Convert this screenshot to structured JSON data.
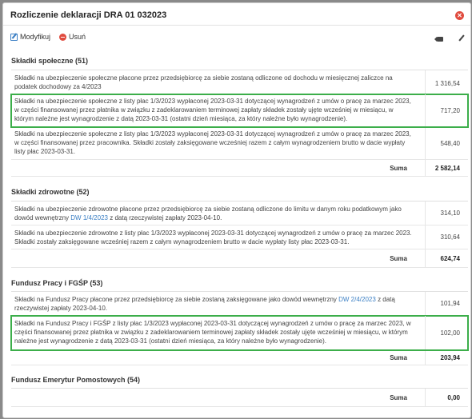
{
  "dialog": {
    "title": "Rozliczenie deklaracji DRA 01 032023",
    "toolbar": {
      "edit": "Modyfikuj",
      "delete": "Usuń"
    },
    "icons": {
      "close": "close-icon",
      "edit": "edit-icon",
      "delete": "delete-icon",
      "tag": "tag-icon",
      "pencil": "pencil-icon"
    },
    "colors": {
      "highlight": "#3cae4a",
      "close": "#e04b3e",
      "link": "#3b7fc4"
    }
  },
  "sections": [
    {
      "title": "Składki społeczne (51)",
      "rows": [
        {
          "text": "Składki na ubezpieczenie społeczne płacone przez przedsiębiorcę za siebie zostaną odliczone od dochodu w miesięcznej zaliczce na podatek dochodowy za 4/2023",
          "amount": "1 316,54"
        },
        {
          "text": "Składki na ubezpieczenie społeczne z listy płac 1/3/2023 wypłaconej 2023-03-31 dotyczącej wynagrodzeń z umów o pracę za marzec 2023, w części finansowanej przez płatnika w związku z zadeklarowaniem terminowej zapłaty składek zostały ujęte wcześniej w miesiącu, w którym należne jest wynagrodzenie z datą 2023-03-31 (ostatni dzień miesiąca, za który należne było wynagrodzenie).",
          "amount": "717,20"
        },
        {
          "text": "Składki na ubezpieczenie społeczne z listy płac 1/3/2023 wypłaconej 2023-03-31 dotyczącej wynagrodzeń z umów o pracę za marzec 2023, w części finansowanej przez pracownika. Składki zostały zaksięgowane wcześniej razem z całym wynagrodzeniem brutto w dacie wypłaty listy płac 2023-03-31.",
          "amount": "548,40"
        }
      ],
      "sum_label": "Suma",
      "sum": "2 582,14"
    },
    {
      "title": "Składki zdrowotne (52)",
      "rows": [
        {
          "text": "Składki na ubezpieczenie zdrowotne płacone przez przedsiębiorcę za siebie zostaną odliczone do limitu w danym roku podatkowym jako dowód wewnętrzny",
          "link": "DW 1/4/2023",
          "text_after": "z datą rzeczywistej zapłaty 2023-04-10.",
          "amount": "314,10"
        },
        {
          "text": "Składki na ubezpieczenie zdrowotne z listy płac 1/3/2023 wypłaconej 2023-03-31 dotyczącej wynagrodzeń z umów o pracę za marzec 2023. Składki zostały zaksięgowane wcześniej razem z całym wynagrodzeniem brutto w dacie wypłaty listy płac 2023-03-31.",
          "amount": "310,64"
        }
      ],
      "sum_label": "Suma",
      "sum": "624,74"
    },
    {
      "title": "Fundusz Pracy i FGŚP (53)",
      "rows": [
        {
          "text": "Składki na Fundusz Pracy płacone przez przedsiębiorcę za siebie zostaną zaksięgowane jako dowód wewnętrzny",
          "link": "DW 2/4/2023",
          "text_after": "z datą rzeczywistej zapłaty 2023-04-10.",
          "amount": "101,94"
        },
        {
          "text": "Składki na Fundusz Pracy i FGŚP z listy płac 1/3/2023 wypłaconej 2023-03-31 dotyczącej wynagrodzeń z umów o pracę za marzec 2023, w części finansowanej przez płatnika w związku z zadeklarowaniem terminowej zapłaty składek zostały ujęte wcześniej w miesiącu, w którym należne jest wynagrodzenie z datą 2023-03-31 (ostatni dzień miesiąca, za który należne było wynagrodzenie).",
          "amount": "102,00"
        }
      ],
      "sum_label": "Suma",
      "sum": "203,94"
    },
    {
      "title": "Fundusz Emerytur Pomostowych (54)",
      "rows": [],
      "sum_label": "Suma",
      "sum": "0,00"
    }
  ]
}
